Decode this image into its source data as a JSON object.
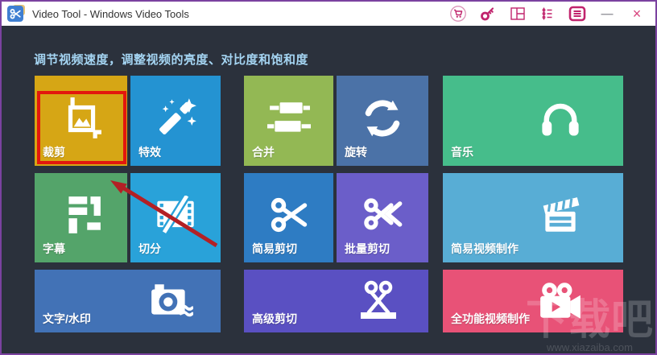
{
  "window": {
    "title": "Video Tool - Windows Video Tools",
    "colors": {
      "window_border": "#7b42a0",
      "titlebar_bg": "#ffffff",
      "content_bg": "#2b313c",
      "toolbar_accent": "#c1246d",
      "heading_text": "#a5d5f3",
      "highlight_red": "#e3170d",
      "arrow_red": "#b32025"
    }
  },
  "titlebar": {
    "title": "Video Tool - Windows Video Tools",
    "app_icon": "scissors-app-icon",
    "action_icons": [
      "cart-icon",
      "key-icon",
      "layout-icon",
      "playlist-icon",
      "menu-icon"
    ],
    "minimize_label": "—",
    "close_label": "×"
  },
  "heading": "调节视频速度，调整视频的亮度、对比度和饱和度",
  "tiles": [
    {
      "label": "裁剪",
      "color": "#d6a615",
      "icon": "crop-icon",
      "highlighted": true
    },
    {
      "label": "特效",
      "color": "#2493d2",
      "icon": "magic-wand-icon"
    },
    {
      "label": "合并",
      "color": "#93b854",
      "icon": "merge-icon"
    },
    {
      "label": "旋转",
      "color": "#4b72a7",
      "icon": "rotate-icon"
    },
    {
      "label": "音乐",
      "color": "#46bd8b",
      "icon": "headphones-icon"
    },
    {
      "label": "字幕",
      "color": "#54a46a",
      "icon": "subtitle-icon"
    },
    {
      "label": "切分",
      "color": "#29a2d9",
      "icon": "film-split-icon"
    },
    {
      "label": "简易剪切",
      "color": "#2e7cc3",
      "icon": "scissors-icon"
    },
    {
      "label": "批量剪切",
      "color": "#6b5ec9",
      "icon": "batch-scissors-icon"
    },
    {
      "label": "简易视频制作",
      "color": "#58add5",
      "icon": "clapperboard-icon"
    },
    {
      "label": "文字/水印",
      "color": "#4272b6",
      "icon": "camera-watermark-icon"
    },
    {
      "label": "高级剪切",
      "color": "#5a50c2",
      "icon": "advanced-scissors-icon"
    },
    {
      "label": "全功能视频制作",
      "color": "#e85277",
      "icon": "video-camera-icon"
    }
  ],
  "annotations": {
    "highlighted_tile": "裁剪",
    "highlight_color": "#e3170d",
    "arrow_color": "#b32025"
  },
  "watermark": {
    "text": "下载吧",
    "url": "www.xiazaiba.com"
  }
}
